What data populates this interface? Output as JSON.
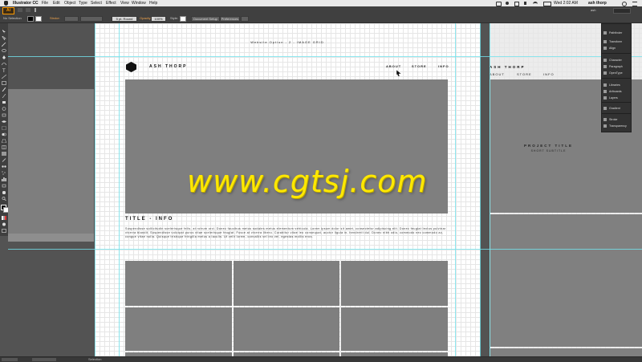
{
  "menubar": {
    "app_name": "Illustrator CC",
    "menus": [
      "File",
      "Edit",
      "Object",
      "Type",
      "Select",
      "Effect",
      "View",
      "Window",
      "Help"
    ],
    "clock": "Wed 2:02 AM",
    "user": "ash thorp"
  },
  "app_logo": "Ai",
  "controlbar": {
    "selection_label": "No Selection",
    "stroke_label": "Stroke:",
    "brush_label": "5 pt. Round",
    "opacity_label": "Opacity:",
    "opacity_value": "100%",
    "style_label": "Style:",
    "doc_setup_label": "Document Setup",
    "preferences_label": "Preferences",
    "workspace_user": "ash"
  },
  "artboard": {
    "doc_title": "Website.Option - 2 - IMAGE GRID",
    "logo_text": "ASH THORP",
    "nav": [
      "ABOUT",
      "STORE",
      "INFO"
    ],
    "section_title": "TITLE - INFO",
    "body_text": "Suspendisse sollicitudin scelerisque felis, at rutrum orci. Donec faucibus metus sodales metus elementum vehicula. Lorem ipsum dolor sit amet, consectetur adipiscing elit. Donec feugiat lectus pulvinar viverra blandit. Suspendisse volutpat purus vitae scelerisque feugiat. Fusce at viverra libero. Curabitur vitae leo consequat, auctor ligula in, hendrerit dui. Donec nibh odio, commodo nec commodo ac, congue vitae nulla. Quisque tristique fringilla metus a iaculis. Ut velit lorem, convallis vel leo vel, egestas mollis eros."
  },
  "right_artboard": {
    "logo_text": "ASH THORP",
    "nav": [
      "ABOUT",
      "STORE",
      "INFO"
    ],
    "project_title": "PROJECT TITLE",
    "project_subtitle": "SHORT SUBTITLE"
  },
  "panels": [
    {
      "label": "Pathfinder",
      "icon": "pathfinder-icon"
    },
    {
      "label": "Transform",
      "icon": "transform-icon"
    },
    {
      "label": "Align",
      "icon": "align-icon"
    },
    {
      "label": "Character",
      "icon": "character-icon"
    },
    {
      "label": "Paragraph",
      "icon": "paragraph-icon"
    },
    {
      "label": "OpenType",
      "icon": "opentype-icon"
    },
    {
      "label": "Libraries",
      "icon": "libraries-icon"
    },
    {
      "label": "Artboards",
      "icon": "artboards-icon"
    },
    {
      "label": "Layers",
      "icon": "layers-icon"
    },
    {
      "label": "Gradient",
      "icon": "gradient-icon"
    },
    {
      "label": "Stroke",
      "icon": "stroke-icon"
    },
    {
      "label": "Transparency",
      "icon": "transparency-icon"
    }
  ],
  "status": {
    "tool": "Selection"
  },
  "watermark": "www.cgtsj.com",
  "colors": {
    "accent_orange": "#ff9a00",
    "guide": "#73e4ee",
    "watermark": "#ffe800"
  }
}
